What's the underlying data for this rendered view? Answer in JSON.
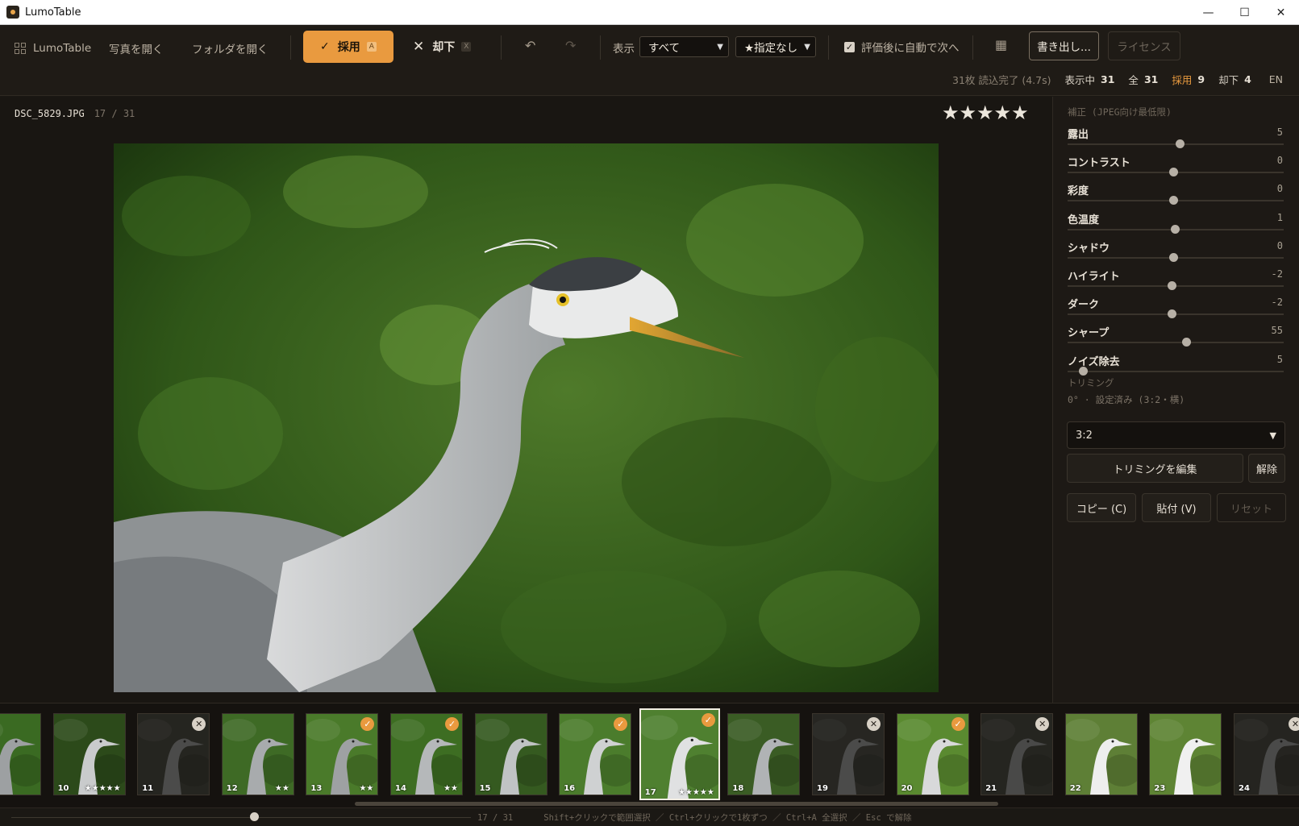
{
  "window": {
    "title": "LumoTable",
    "minimize_glyph": "—",
    "maximize_glyph": "☐",
    "close_glyph": "✕"
  },
  "toolbar": {
    "brand": "LumoTable",
    "open_photo": "写真を開く",
    "open_folder": "フォルダを開く",
    "accept_label": "採用",
    "accept_key": "A",
    "reject_label": "却下",
    "reject_key": "X",
    "undo_glyph": "↶",
    "redo_glyph": "↷",
    "view_label": "表示",
    "view_filter": "すべて",
    "star_filter": "★指定なし",
    "auto_next_label": "評価後に自動で次へ",
    "auto_next_checked": true,
    "export_label": "書き出し...",
    "license_label": "ライセンス"
  },
  "stats": {
    "loaded": "31枚 読込完了 (4.7s)",
    "showing_label": "表示中",
    "showing": "31",
    "total_label": "全",
    "total": "31",
    "accepted_label": "採用",
    "accepted": "9",
    "rejected_label": "却下",
    "rejected": "4",
    "lang": "EN"
  },
  "viewer": {
    "filename": "DSC_5829.JPG",
    "index": "17 / 31",
    "stars": "★★★★★",
    "rating": 5
  },
  "adjust": {
    "section": "補正 (JPEG向け最低限)",
    "items": [
      {
        "label": "露出",
        "value": "5",
        "position": 0.52
      },
      {
        "label": "コントラスト",
        "value": "0",
        "position": 0.49
      },
      {
        "label": "彩度",
        "value": "0",
        "position": 0.49
      },
      {
        "label": "色温度",
        "value": "1",
        "position": 0.495
      },
      {
        "label": "シャドウ",
        "value": "0",
        "position": 0.49
      },
      {
        "label": "ハイライト",
        "value": "-2",
        "position": 0.48
      },
      {
        "label": "ダーク",
        "value": "-2",
        "position": 0.48
      },
      {
        "label": "シャープ",
        "value": "55",
        "position": 0.55
      },
      {
        "label": "ノイズ除去",
        "value": "5",
        "position": 0.07
      }
    ]
  },
  "trim": {
    "section": "トリミング",
    "status": "0° · 設定済み (3:2・横)",
    "ratio": "3:2",
    "edit_label": "トリミングを編集",
    "clear_label": "解除"
  },
  "actions": {
    "copy": "コピー (C)",
    "paste": "貼付 (V)",
    "reset": "リセット"
  },
  "filmstrip": [
    {
      "num": "",
      "stars": "",
      "status": "none"
    },
    {
      "num": "10",
      "stars": "★★★★★",
      "status": "none"
    },
    {
      "num": "11",
      "stars": "",
      "status": "rejected"
    },
    {
      "num": "12",
      "stars": "★★",
      "status": "none"
    },
    {
      "num": "13",
      "stars": "★★",
      "status": "accepted"
    },
    {
      "num": "14",
      "stars": "★★",
      "status": "accepted"
    },
    {
      "num": "15",
      "stars": "",
      "status": "none"
    },
    {
      "num": "16",
      "stars": "",
      "status": "accepted"
    },
    {
      "num": "17",
      "stars": "★★★★★",
      "status": "accepted",
      "selected": true
    },
    {
      "num": "18",
      "stars": "",
      "status": "none"
    },
    {
      "num": "19",
      "stars": "",
      "status": "rejected"
    },
    {
      "num": "20",
      "stars": "",
      "status": "accepted"
    },
    {
      "num": "21",
      "stars": "",
      "status": "rejected"
    },
    {
      "num": "22",
      "stars": "",
      "status": "none"
    },
    {
      "num": "23",
      "stars": "",
      "status": "none"
    },
    {
      "num": "24",
      "stars": "",
      "status": "rejected"
    }
  ],
  "statusbar": {
    "counter": "17 / 31",
    "hint": "Shift+クリックで範囲選択 ／ Ctrl+クリックで1枚ずつ ／ Ctrl+A 全選択 ／ Esc で解除"
  },
  "icons": {
    "accept": "check-icon",
    "reject": "x-icon",
    "grid": "grid-icon",
    "dropdown": "chevron-down-icon"
  },
  "colors": {
    "accent": "#e99a3f",
    "background": "#1b1814",
    "panel": "#1d1915"
  }
}
